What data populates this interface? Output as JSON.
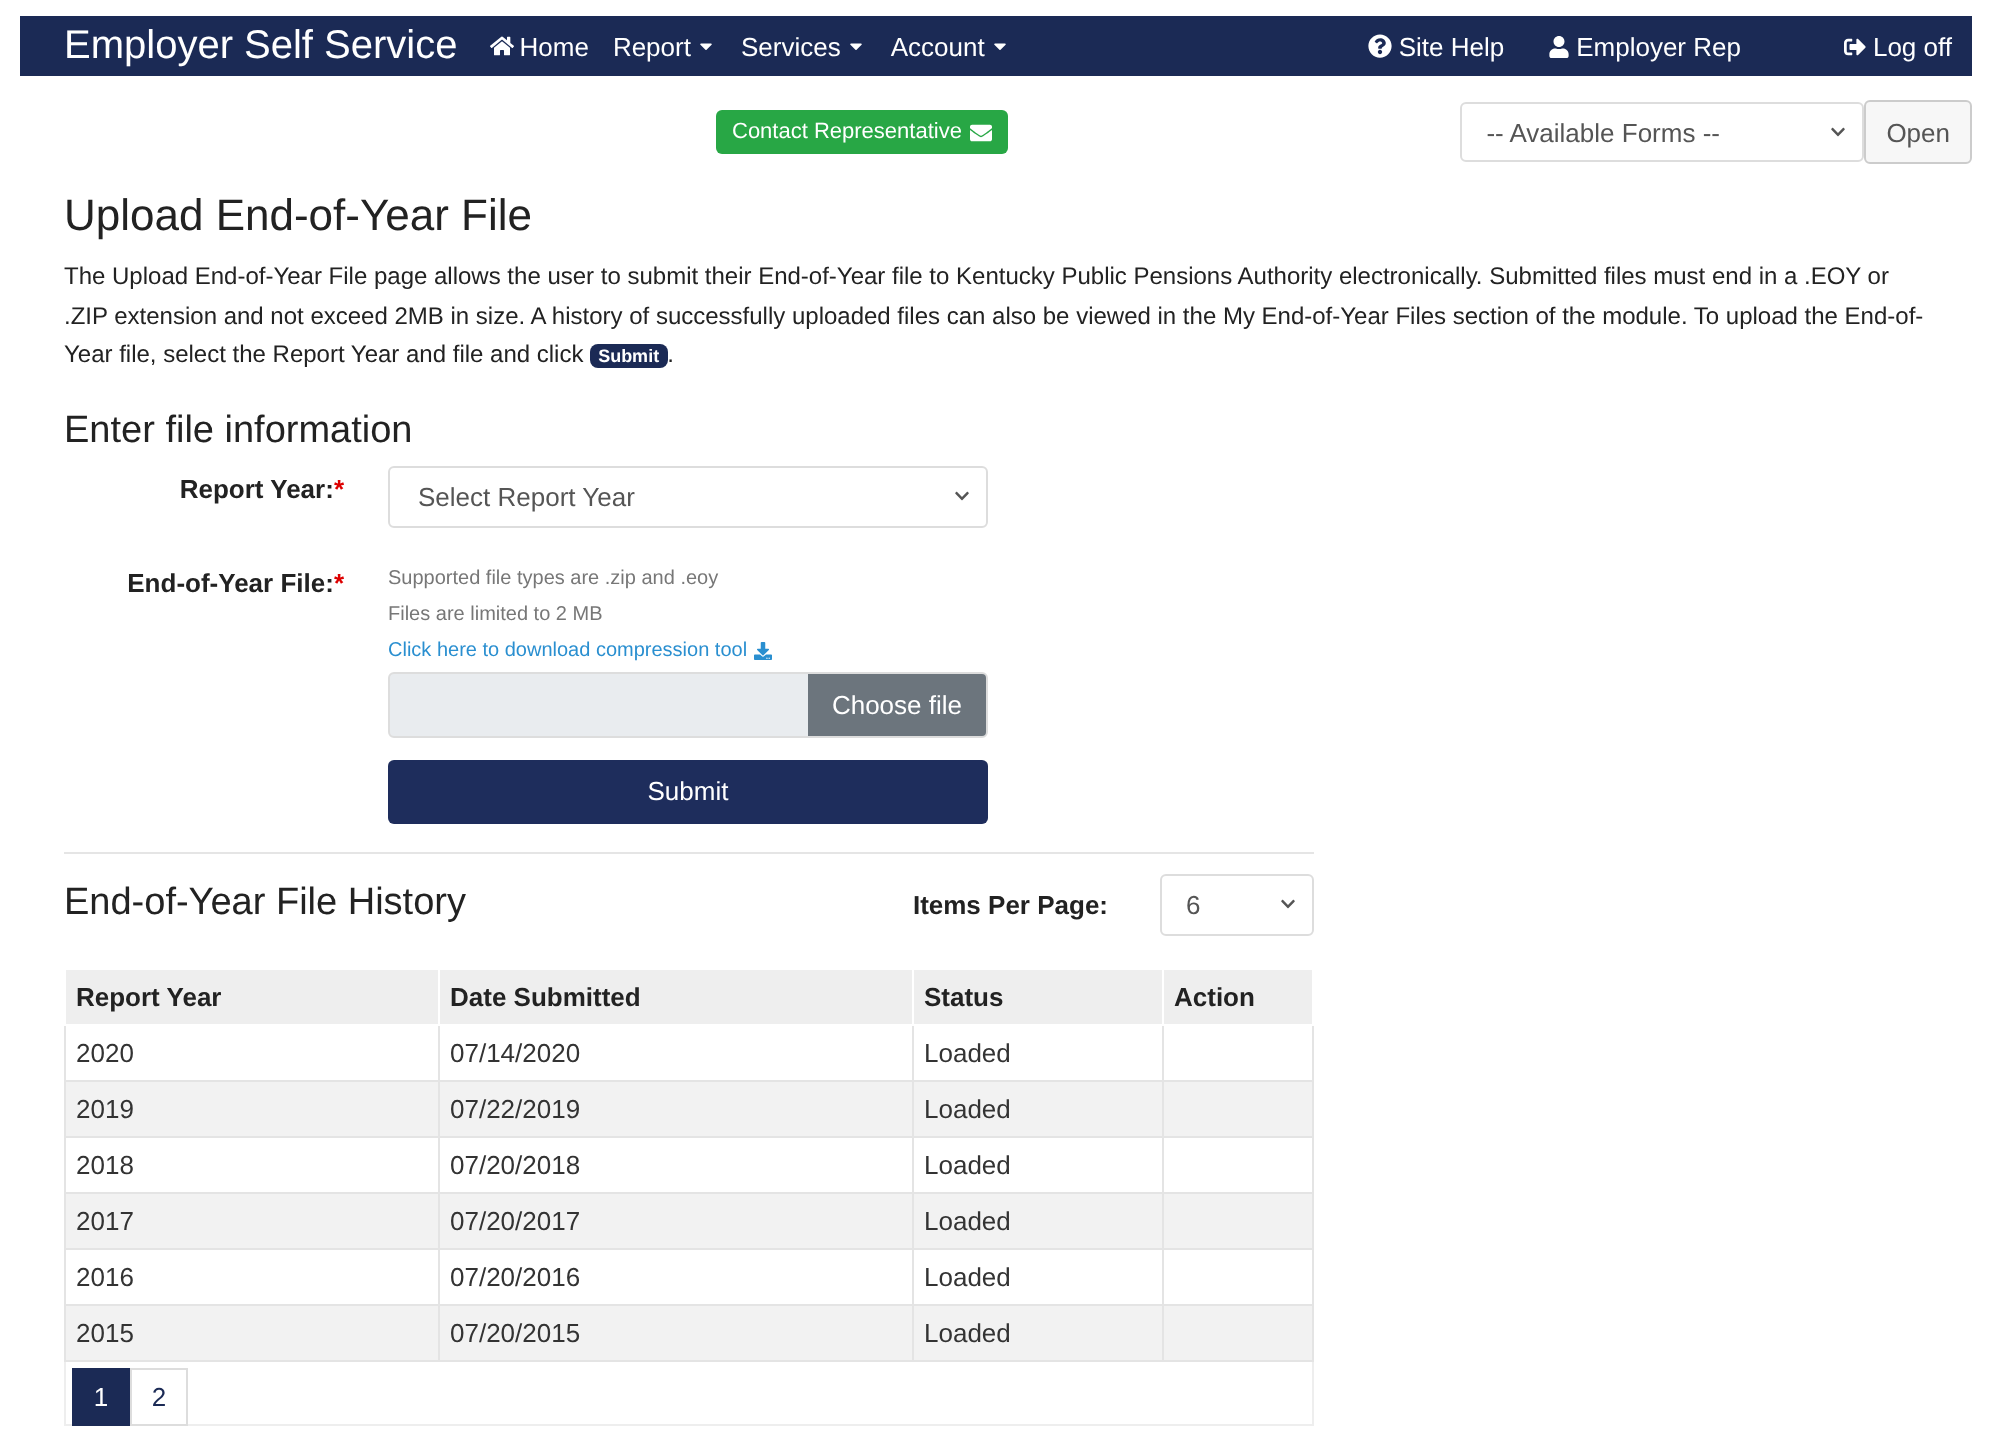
{
  "navbar": {
    "brand": "Employer Self Service",
    "items": [
      {
        "label": "Home",
        "kind": "home"
      },
      {
        "label": "Report",
        "kind": "dropdown"
      },
      {
        "label": "Services",
        "kind": "dropdown"
      },
      {
        "label": "Account",
        "kind": "dropdown"
      }
    ],
    "right_items": [
      {
        "label": "Site Help",
        "kind": "help"
      },
      {
        "label": "Employer Rep",
        "kind": "user"
      },
      {
        "label": "Log off",
        "kind": "logoff"
      }
    ]
  },
  "contact_button": "Contact Representative",
  "forms_select": {
    "value": "-- Available Forms --"
  },
  "open_button": "Open",
  "page_title": "Upload End-of-Year File",
  "intro": {
    "text_before": "The Upload End-of-Year File page allows the user to submit their End-of-Year file to Kentucky Public Pensions Authority electronically. Submitted files must end in a .EOY or .ZIP extension and not exceed 2MB in size. A history of successfully uploaded files can also be viewed in the My End-of-Year Files section of the module. To upload the End-of-Year file, select the Report Year and file and click",
    "badge": "Submit",
    "text_after": "."
  },
  "form": {
    "heading": "Enter file information",
    "report_year": {
      "label": "Report Year:",
      "required_mark": "*",
      "value": "Select Report Year"
    },
    "file": {
      "label": "End-of-Year File:",
      "required_mark": "*",
      "hints": [
        "Supported file types are .zip and .eoy",
        "Files are limited to 2 MB"
      ],
      "download_link": "Click here to download compression tool",
      "choose_button": "Choose file"
    },
    "submit_button": "Submit"
  },
  "history": {
    "heading": "End-of-Year File History",
    "items_per_page": {
      "label": "Items Per Page:",
      "value": "6"
    },
    "table": {
      "columns": [
        "Report Year",
        "Date Submitted",
        "Status",
        "Action"
      ],
      "rows": [
        [
          "2020",
          "07/14/2020",
          "Loaded"
        ],
        [
          "2019",
          "07/22/2019",
          "Loaded"
        ],
        [
          "2018",
          "07/20/2018",
          "Loaded"
        ],
        [
          "2017",
          "07/20/2017",
          "Loaded"
        ],
        [
          "2016",
          "07/20/2016",
          "Loaded"
        ],
        [
          "2015",
          "07/20/2015",
          "Loaded"
        ]
      ]
    },
    "pages": [
      {
        "label": "1",
        "selected": true
      },
      {
        "label": "2",
        "selected": false
      }
    ]
  }
}
